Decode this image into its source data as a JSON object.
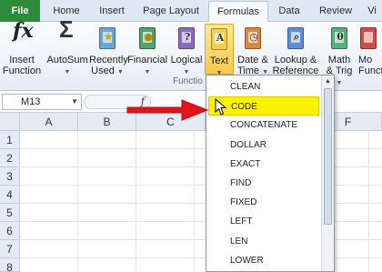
{
  "tabs": [
    {
      "label": "File"
    },
    {
      "label": "Home"
    },
    {
      "label": "Insert"
    },
    {
      "label": "Page Layout"
    },
    {
      "label": "Formulas"
    },
    {
      "label": "Data"
    },
    {
      "label": "Review"
    },
    {
      "label": "Vi"
    }
  ],
  "ribbon": {
    "insert_function": {
      "line1": "Insert",
      "line2": "Function",
      "icon": "fx-icon"
    },
    "autosum": {
      "line1": "AutoSum",
      "icon": "sigma-icon"
    },
    "recently_used": {
      "line1": "Recently",
      "line2": "Used",
      "icon": "book-star-icon"
    },
    "financial": {
      "line1": "Financial",
      "icon": "book-coins-icon"
    },
    "logical": {
      "line1": "Logical",
      "icon": "book-question-icon"
    },
    "text": {
      "line1": "Text",
      "icon": "book-a-icon",
      "glyph": "A"
    },
    "date_time": {
      "line1": "Date &",
      "line2": "Time",
      "icon": "book-clock-icon"
    },
    "lookup": {
      "line1": "Lookup &",
      "line2": "Reference",
      "icon": "book-magnifier-icon"
    },
    "math": {
      "line1": "Math",
      "line2": "& Trig",
      "icon": "book-theta-icon",
      "glyph": "θ"
    },
    "more": {
      "line1": "Mo",
      "line2": "Functi",
      "icon": "book-more-icon"
    },
    "group_label": "Functio"
  },
  "formula_bar": {
    "name_box": "M13",
    "fx_label": "f"
  },
  "grid": {
    "columns": [
      "A",
      "B",
      "C",
      "F"
    ],
    "rows": [
      "1",
      "2",
      "3",
      "4",
      "5",
      "6",
      "7",
      "8"
    ]
  },
  "menu": {
    "items": [
      "CLEAN",
      "CODE",
      "CONCATENATE",
      "DOLLAR",
      "EXACT",
      "FIND",
      "FIXED",
      "LEFT",
      "LEN",
      "LOWER"
    ],
    "highlighted": "CODE"
  },
  "colors": {
    "file_tab": "#2e8b3a",
    "highlight": "#fff200",
    "arrow": "#e0161a",
    "text_button_active": "#f8c94a"
  }
}
